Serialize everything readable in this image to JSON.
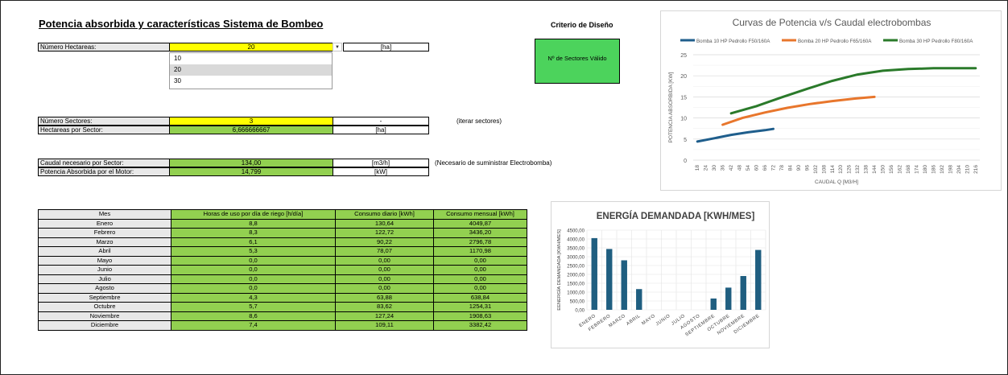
{
  "sheet": {
    "title": "Potencia absorbida y características Sistema de Bombeo",
    "hectareas": {
      "label": "Número Hectareas:",
      "value": "20",
      "unit": "[ha]"
    },
    "dropdown": {
      "options": [
        "10",
        "20",
        "30"
      ],
      "selected": "20"
    },
    "sectores": {
      "label": "Número Sectores:",
      "value": "3",
      "unit": "-",
      "note": "(iterar sectores)"
    },
    "hect_sector": {
      "label": "Hectareas por Sector:",
      "value": "6,666666667",
      "unit": "[ha]"
    },
    "caudal": {
      "label": "Caudal necesario por Sector:",
      "value": "134,00",
      "unit": "[m3/h]",
      "note": "(Necesario de suministrar Electrobomba)"
    },
    "potencia": {
      "label": "Potencia Absorbida por el Motor:",
      "value": "14,799",
      "unit": "[kW]"
    },
    "criterio": {
      "title": "Criterio de Diseño",
      "status": "Nº de Sectores Válido"
    }
  },
  "table": {
    "headers": [
      "Mes",
      "Horas de uso por día de riego [h/día]",
      "Consumo diario [kWh]",
      "Consumo mensual [kWh]"
    ],
    "rows": [
      [
        "Enero",
        "8,8",
        "130,64",
        "4049,87"
      ],
      [
        "Febrero",
        "8,3",
        "122,72",
        "3436,20"
      ],
      [
        "Marzo",
        "6,1",
        "90,22",
        "2796,78"
      ],
      [
        "Abril",
        "5,3",
        "78,07",
        "1170,98"
      ],
      [
        "Mayo",
        "0,0",
        "0,00",
        "0,00"
      ],
      [
        "Junio",
        "0,0",
        "0,00",
        "0,00"
      ],
      [
        "Julio",
        "0,0",
        "0,00",
        "0,00"
      ],
      [
        "Agosto",
        "0,0",
        "0,00",
        "0,00"
      ],
      [
        "Septiembre",
        "4,3",
        "63,88",
        "638,84"
      ],
      [
        "Octubre",
        "5,7",
        "83,62",
        "1254,31"
      ],
      [
        "Noviembre",
        "8,6",
        "127,24",
        "1908,63"
      ],
      [
        "Diciembre",
        "7,4",
        "109,11",
        "3382,42"
      ]
    ]
  },
  "chart_data": [
    {
      "type": "line",
      "title": "Curvas de Potencia v/s Caudal electrobombas",
      "xlabel": "CAUDAL Q [M3/H]",
      "ylabel": "POTENCIA ABSORBIDA [KW]",
      "ylim": [
        0,
        25
      ],
      "yticks": [
        "0",
        "5",
        "10",
        "15",
        "20",
        "25"
      ],
      "xticks": [
        "18",
        "24",
        "30",
        "36",
        "42",
        "48",
        "54",
        "60",
        "66",
        "72",
        "78",
        "84",
        "90",
        "96",
        "102",
        "108",
        "114",
        "120",
        "126",
        "132",
        "138",
        "144",
        "150",
        "156",
        "162",
        "168",
        "174",
        "180",
        "186",
        "192",
        "198",
        "204",
        "210",
        "216"
      ],
      "legend_position": "top",
      "series": [
        {
          "name": "Bomba 10 HP Pedrollo F50/160A",
          "color": "#1f5e8c",
          "x": [
            18,
            30,
            42,
            54,
            66,
            72
          ],
          "y": [
            4.4,
            5.2,
            6.0,
            6.6,
            7.1,
            7.4
          ]
        },
        {
          "name": "Bomba 20 HP Pedrollo F65/160A",
          "color": "#e8762c",
          "x": [
            36,
            50,
            66,
            82,
            98,
            114,
            130,
            144
          ],
          "y": [
            8.4,
            10.0,
            11.3,
            12.4,
            13.3,
            14.0,
            14.6,
            15.0
          ]
        },
        {
          "name": "Bomba 30 HP Pedrollo F80/160A",
          "color": "#2a7a2a",
          "x": [
            42,
            60,
            78,
            96,
            114,
            132,
            150,
            168,
            186,
            204,
            216
          ],
          "y": [
            11.1,
            12.8,
            14.9,
            16.9,
            18.8,
            20.3,
            21.2,
            21.6,
            21.8,
            21.8,
            21.8
          ]
        }
      ]
    },
    {
      "type": "bar",
      "title": "ENERGÍA DEMANDADA [KWH/MES]",
      "ylabel": "EENERGÍA DEMANDADA [KWH/MES]",
      "ylim": [
        0,
        4500
      ],
      "yticks": [
        "0,00",
        "500,00",
        "1000,00",
        "1500,00",
        "2000,00",
        "2500,00",
        "3000,00",
        "3500,00",
        "4000,00",
        "4500,00"
      ],
      "categories": [
        "ENERO",
        "FEBRERO",
        "MARZO",
        "ABRIL",
        "MAYO",
        "JUNIO",
        "JULIO",
        "AGOSTO",
        "SEPTIEMBRE",
        "OCTUBRE",
        "NOVIEMBRE",
        "DICIEMBRE"
      ],
      "values": [
        4049.87,
        3436.2,
        2796.78,
        1170.98,
        0,
        0,
        0,
        0,
        638.84,
        1254.31,
        1908.63,
        3382.42
      ],
      "color": "#1f5e80",
      "grid": true
    }
  ]
}
